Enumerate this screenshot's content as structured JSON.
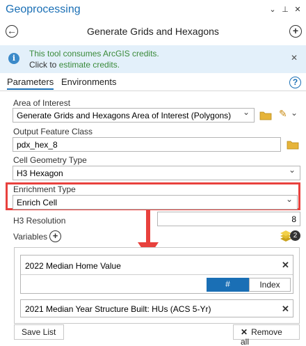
{
  "pane": {
    "title": "Geoprocessing",
    "controls": {
      "menu": "⌄",
      "pin": "⊥",
      "close": "✕"
    }
  },
  "tool": {
    "title": "Generate Grids and Hexagons",
    "back": "←",
    "add": "+"
  },
  "banner": {
    "line1": "This tool consumes ArcGIS credits.",
    "line2_prefix": "Click to ",
    "line2_link": "estimate credits.",
    "info_glyph": "i",
    "close": "✕"
  },
  "tabs": {
    "parameters": "Parameters",
    "environments": "Environments",
    "help": "?"
  },
  "params": {
    "area_label": "Area of Interest",
    "area_value": "Generate Grids and Hexagons Area of Interest (Polygons)",
    "output_label": "Output Feature Class",
    "output_value": "pdx_hex_8",
    "cell_label": "Cell Geometry Type",
    "cell_value": "H3 Hexagon",
    "enrich_label": "Enrichment Type",
    "enrich_value": "Enrich Cell",
    "h3_label": "H3 Resolution",
    "h3_value": "8",
    "variables_label": "Variables",
    "variables_add": "+",
    "variables_count": "2"
  },
  "variables": [
    {
      "name": "2022 Median Home Value",
      "close": "✕"
    },
    {
      "name": "2021 Median Year Structure Built: HUs (ACS 5-Yr)",
      "close": "✕"
    }
  ],
  "toggle": {
    "hash": "#",
    "index": "Index"
  },
  "buttons": {
    "save_list": "Save List",
    "remove_all": "Remove all",
    "remove_glyph": "✕"
  },
  "colors": {
    "accent": "#1a6fb5",
    "highlight": "#e8413d",
    "banner_bg": "#e3f0fa",
    "credit_text": "#3a8a3a"
  }
}
